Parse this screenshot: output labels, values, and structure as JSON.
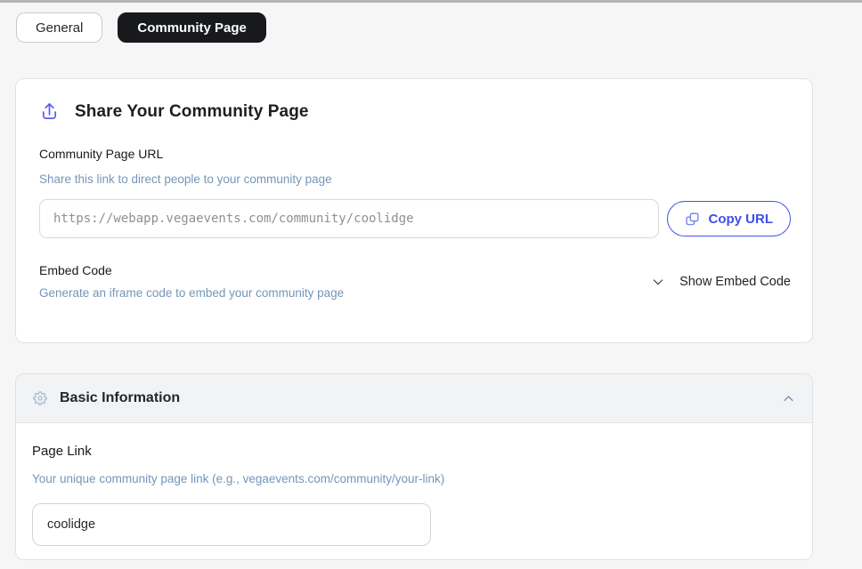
{
  "tabs": {
    "general": "General",
    "community_page": "Community Page"
  },
  "share": {
    "title": "Share Your Community Page",
    "url_label": "Community Page URL",
    "url_helper": "Share this link to direct people to your community page",
    "url_value": "https://webapp.vegaevents.com/community/coolidge",
    "copy_button": "Copy URL",
    "embed_label": "Embed Code",
    "embed_helper": "Generate an iframe code to embed your community page",
    "show_embed": "Show Embed Code"
  },
  "basic": {
    "title": "Basic Information",
    "page_link_label": "Page Link",
    "page_link_helper": "Your unique community page link (e.g., vegaevents.com/community/your-link)",
    "page_link_value": "coolidge"
  },
  "icons": {
    "share_header": "upload-icon",
    "copy_button": "copy-icon",
    "embed_toggle": "chevron-down-icon",
    "basic_header": "gear-icon",
    "basic_toggle": "chevron-up-icon"
  },
  "colors": {
    "accent_blue": "#4353e8",
    "upload_icon_blue": "#5a5bf0",
    "copy_icon_blue": "#7a86ef",
    "helper_text_blue": "#7496b8",
    "gear_icon_blue": "#a3b6d6",
    "chevron_up_blue": "#7691b4",
    "active_tab_bg": "#17191c",
    "page_bg": "#f6f6f7",
    "header_strip_bg": "#f2f3f5"
  }
}
